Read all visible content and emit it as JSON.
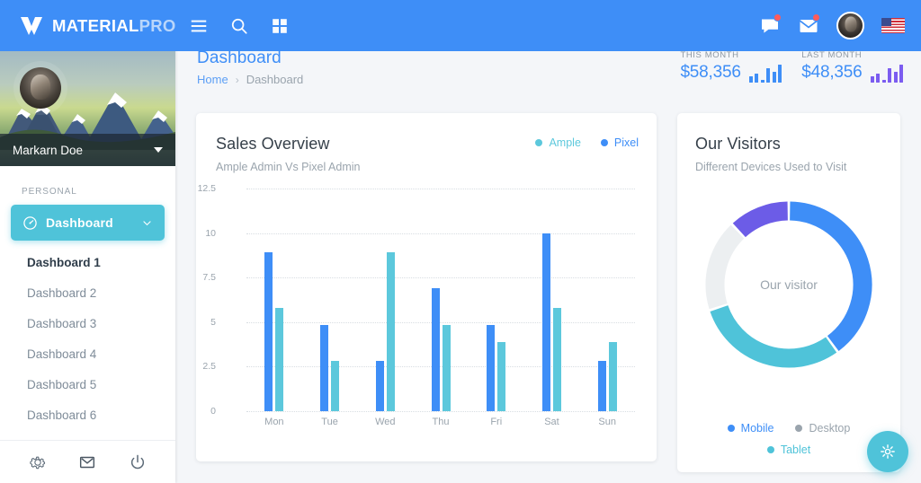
{
  "brand": {
    "part1": "MATERIAL",
    "part2": "PRO",
    "logo_icon": "material-pro-logo-icon"
  },
  "topbar": {
    "menu_icon": "hamburger-menu-icon",
    "search_icon": "search-icon",
    "apps_icon": "grid-apps-icon",
    "chat_icon": "chat-bubble-icon",
    "mail_icon": "envelope-icon",
    "avatar_icon": "user-avatar",
    "flag_icon": "us-flag-icon",
    "accent": "#3e8ef7"
  },
  "sidebar": {
    "user_name": "Markarn Doe",
    "caret_icon": "caret-down-icon",
    "section_label": "PERSONAL",
    "active_item": {
      "label": "Dashboard",
      "icon": "speedometer-icon",
      "chevron": "chevron-down-icon",
      "color": "#4fc3d9"
    },
    "sub_items": [
      {
        "label": "Dashboard 1",
        "current": true
      },
      {
        "label": "Dashboard 2",
        "current": false
      },
      {
        "label": "Dashboard 3",
        "current": false
      },
      {
        "label": "Dashboard 4",
        "current": false
      },
      {
        "label": "Dashboard 5",
        "current": false
      },
      {
        "label": "Dashboard 6",
        "current": false
      }
    ],
    "footer_icons": [
      "gear-icon",
      "mail-icon",
      "power-icon"
    ]
  },
  "page": {
    "title": "Dashboard",
    "breadcrumb": {
      "home": "Home",
      "separator": "›",
      "current": "Dashboard"
    }
  },
  "stats": [
    {
      "label": "THIS MONTH",
      "value": "$58,356",
      "color": "#3e8ef7",
      "spark": [
        7,
        10,
        3,
        16,
        12,
        20
      ]
    },
    {
      "label": "LAST MONTH",
      "value": "$48,356",
      "color": "#7b5cf0",
      "spark": [
        7,
        10,
        3,
        16,
        12,
        20
      ]
    }
  ],
  "sales_card": {
    "title": "Sales Overview",
    "subtitle": "Ample Admin Vs Pixel Admin",
    "legend": [
      {
        "label": "Ample",
        "color": "#5cc8dc"
      },
      {
        "label": "Pixel",
        "color": "#3e8ef7"
      }
    ]
  },
  "visitors_card": {
    "title": "Our Visitors",
    "subtitle": "Different Devices Used to Visit",
    "center_label": "Our visitor",
    "legend": [
      {
        "label": "Mobile",
        "color": "#3e8ef7"
      },
      {
        "label": "Desktop",
        "color": "#9aa4ad"
      },
      {
        "label": "Tablet",
        "color": "#4fc3d9"
      }
    ]
  },
  "fab": {
    "icon": "gear-icon",
    "color": "#4fc3d9"
  },
  "chart_data": [
    {
      "type": "bar",
      "title": "Sales Overview",
      "subtitle": "Ample Admin Vs Pixel Admin",
      "categories": [
        "Mon",
        "Tue",
        "Wed",
        "Thu",
        "Fri",
        "Sat",
        "Sun"
      ],
      "series": [
        {
          "name": "Pixel",
          "color": "#3e8ef7",
          "values": [
            8.9,
            4.85,
            2.8,
            6.9,
            4.85,
            10.0,
            2.8
          ]
        },
        {
          "name": "Ample",
          "color": "#5cc8dc",
          "values": [
            5.8,
            2.8,
            8.9,
            4.85,
            3.9,
            5.8,
            3.9
          ]
        }
      ],
      "xlabel": "",
      "ylabel": "",
      "ylim": [
        0,
        12.5
      ],
      "yticks": [
        0,
        2.5,
        5,
        10,
        12.5
      ],
      "ytick_labels": [
        "0",
        "2.5",
        "5",
        "7.5",
        "10",
        "12.5"
      ],
      "ytick_values": [
        0,
        2.5,
        5,
        7.5,
        10,
        12.5
      ],
      "grid": true,
      "legend_position": "top-right"
    },
    {
      "type": "pie",
      "title": "Our Visitors",
      "subtitle": "Different Devices Used to Visit",
      "center_label": "Our visitor",
      "labels": [
        "Mobile",
        "Tablet",
        "Desktop",
        "Purple"
      ],
      "values": [
        40,
        30,
        18,
        12
      ],
      "colors": [
        "#3e8ef7",
        "#4fc3d9",
        "#eceff1",
        "#6c5ce7"
      ],
      "legend_position": "bottom"
    }
  ]
}
